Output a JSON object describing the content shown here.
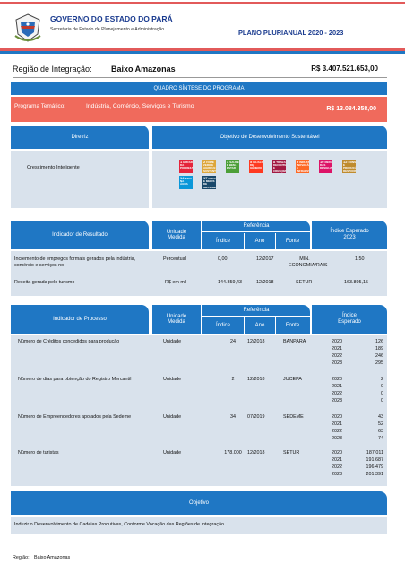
{
  "header": {
    "title": "GOVERNO DO ESTADO DO PARÁ",
    "subtitle": "Secretaria de Estado de Planejamento e Administração",
    "plan": "PLANO PLURIANUAL  2020 - 2023"
  },
  "region": {
    "label": "Região de Integração:",
    "name": "Baixo Amazonas",
    "value": "R$ 3.407.521.653,00"
  },
  "summary_title": "QUADRO SÍNTESE DO PROGRAMA",
  "program": {
    "label": "Programa Temático:",
    "name": "Indústria, Comércio, Serviços e Turismo",
    "value": "R$ 13.084.358,00"
  },
  "diretriz": {
    "header": "Diretriz",
    "value": "Crescimento Inteligente"
  },
  "ods": {
    "header": "Objetivo de Desenvolvimento Sustentável",
    "goals": [
      {
        "num": "1",
        "label": "ERRADICAÇÃO DA POBREZA",
        "color": "#e5243b"
      },
      {
        "num": "2",
        "label": "FOME ZERO E AGRICULTURA SUSTENTÁVEL",
        "color": "#dda63a"
      },
      {
        "num": "3",
        "label": "SAÚDE E BEM-ESTAR",
        "color": "#4c9f38"
      },
      {
        "num": "5",
        "label": "IGUALDADE DE GÊNERO",
        "color": "#ff3a21"
      },
      {
        "num": "8",
        "label": "TRABALHO DECENTE E CRESCIMENTO ECONÔMICO",
        "color": "#a21942"
      },
      {
        "num": "9",
        "label": "INDÚSTRIA, INOVAÇÃO E INFRAESTRUTURA",
        "color": "#fd6925"
      },
      {
        "num": "10",
        "label": "REDUÇÃO DAS DESIGUALDADES",
        "color": "#dd1367"
      },
      {
        "num": "12",
        "label": "CONSUMO E PRODUÇÃO RESPONSÁVEIS",
        "color": "#bf8b2e"
      },
      {
        "num": "14",
        "label": "VIDA NA ÁGUA",
        "color": "#0a97d9"
      },
      {
        "num": "17",
        "label": "PARCERIAS E MEIOS DE IMPLEMENTAÇÃO",
        "color": "#19486a"
      }
    ]
  },
  "result_table": {
    "headers": {
      "indicator": "Indicador de Resultado",
      "unit": "Unidade Medida",
      "reference": "Referência",
      "index": "Índice",
      "year": "Ano",
      "source": "Fonte",
      "expected": "Índice Esperado 2023"
    },
    "rows": [
      {
        "indicator": "Incremento de empregos formais gerados pela indústria, comércio e serviços no",
        "unit": "Percentual",
        "index": "0,00",
        "year": "12/2017",
        "source": "MIN. ECONOMIA/RAIS",
        "expected": "1,50"
      },
      {
        "indicator": "Receita gerada pelo turismo",
        "unit": "R$ em mil",
        "index": "144.859,43",
        "year": "12/2018",
        "source": "SETUR",
        "expected": "163.895,15"
      }
    ]
  },
  "process_table": {
    "headers": {
      "indicator": "Indicador de Processo",
      "unit": "Unidade Medida",
      "reference": "Referência",
      "index": "Índice",
      "year": "Ano",
      "source": "Fonte",
      "expected": "Índice Esperado"
    },
    "rows": [
      {
        "indicator": "Número de Créditos concedidos para produção",
        "unit": "Unidade",
        "index": "24",
        "year": "12/2018",
        "source": "BANPARA",
        "years": [
          "2020",
          "2021",
          "2022",
          "2023"
        ],
        "values": [
          "126",
          "189",
          "246",
          "295"
        ]
      },
      {
        "indicator": "Número de dias para obtenção do Registro Mercantil",
        "unit": "Unidade",
        "index": "2",
        "year": "12/2018",
        "source": "JUCEPA",
        "years": [
          "2020",
          "2021",
          "2022",
          "2023"
        ],
        "values": [
          "2",
          "0",
          "0",
          "0"
        ]
      },
      {
        "indicator": "Número de Empreendedores apoiados pela Sedeme",
        "unit": "Unidade",
        "index": "34",
        "year": "07/2019",
        "source": "SEDEME",
        "years": [
          "2020",
          "2021",
          "2022",
          "2023"
        ],
        "values": [
          "43",
          "52",
          "63",
          "74"
        ]
      },
      {
        "indicator": "Número de turistas",
        "unit": "Unidade",
        "index": "178.000",
        "year": "12/2018",
        "source": "SETUR",
        "years": [
          "2020",
          "2021",
          "2022",
          "2023"
        ],
        "values": [
          "187.011",
          "191.687",
          "196.479",
          "201.391"
        ]
      }
    ]
  },
  "objective": {
    "header": "Objetivo",
    "value": "Induzir o Desenvolvimento  de Cadeias Produtivas, Conforme Vocação das Regiões de Integração"
  },
  "footer": {
    "label": "Região:",
    "value": "Baixo Amazonas"
  }
}
